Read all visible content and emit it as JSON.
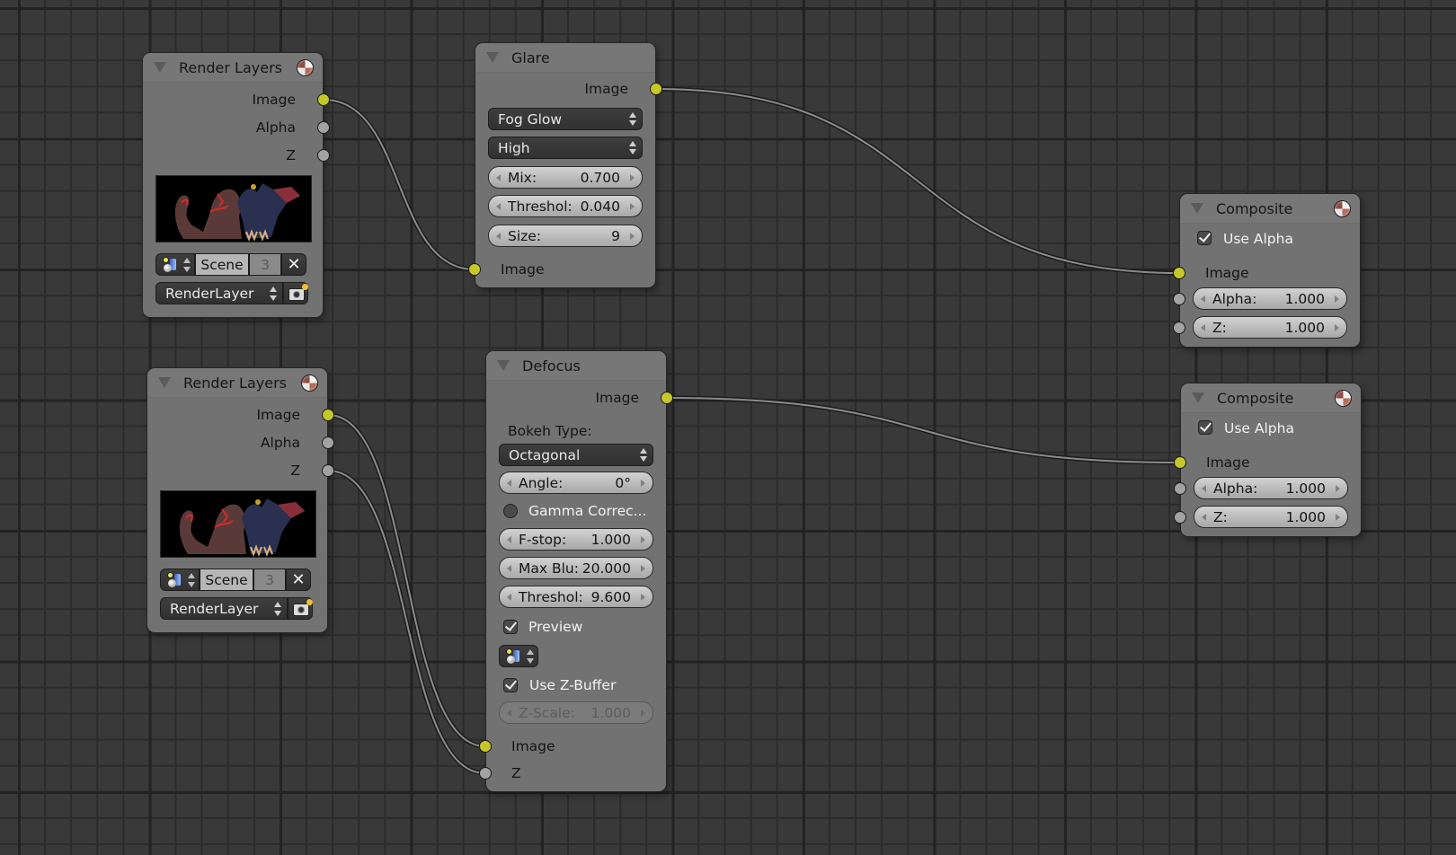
{
  "canvas": {
    "background": "#393939",
    "wire_color": "#8c8c8c",
    "socket_colors": {
      "image": "#c7c729",
      "value": "#a3a3a3"
    }
  },
  "nodes": {
    "render_layers_1": {
      "title": "Render Layers",
      "outputs": [
        "Image",
        "Alpha",
        "Z"
      ],
      "scene": {
        "name": "Scene",
        "users": "3"
      },
      "layer": "RenderLayer"
    },
    "render_layers_2": {
      "title": "Render Layers",
      "outputs": [
        "Image",
        "Alpha",
        "Z"
      ],
      "scene": {
        "name": "Scene",
        "users": "3"
      },
      "layer": "RenderLayer"
    },
    "glare": {
      "title": "Glare",
      "output": "Image",
      "glare_type": "Fog Glow",
      "quality": "High",
      "mix": {
        "label": "Mix:",
        "value": "0.700"
      },
      "threshold": {
        "label": "Threshol:",
        "value": "0.040"
      },
      "size": {
        "label": "Size:",
        "value": "9"
      },
      "input": "Image"
    },
    "defocus": {
      "title": "Defocus",
      "output": "Image",
      "bokeh_label": "Bokeh Type:",
      "bokeh_type": "Octagonal",
      "angle": {
        "label": "Angle:",
        "value": "0°"
      },
      "gamma": {
        "label": "Gamma Correc...",
        "checked": false
      },
      "fstop": {
        "label": "F-stop:",
        "value": "1.000"
      },
      "max_blur": {
        "label": "Max Blu:",
        "value": "20.000"
      },
      "threshold": {
        "label": "Threshol:",
        "value": "9.600"
      },
      "preview": {
        "label": "Preview",
        "checked": true
      },
      "use_zbuffer": {
        "label": "Use Z-Buffer",
        "checked": true
      },
      "zscale": {
        "label": "Z-Scale:",
        "value": "1.000",
        "disabled": true
      },
      "inputs": [
        "Image",
        "Z"
      ]
    },
    "composite_1": {
      "title": "Composite",
      "use_alpha": {
        "label": "Use Alpha",
        "checked": true
      },
      "input": "Image",
      "alpha": {
        "label": "Alpha:",
        "value": "1.000"
      },
      "z": {
        "label": "Z:",
        "value": "1.000"
      }
    },
    "composite_2": {
      "title": "Composite",
      "use_alpha": {
        "label": "Use Alpha",
        "checked": true
      },
      "input": "Image",
      "alpha": {
        "label": "Alpha:",
        "value": "1.000"
      },
      "z": {
        "label": "Z:",
        "value": "1.000"
      }
    }
  },
  "links": [
    {
      "from": "render_layers_1.Image",
      "to": "glare.Image"
    },
    {
      "from": "glare.Image",
      "to": "composite_1.Image"
    },
    {
      "from": "render_layers_2.Image",
      "to": "defocus.Image"
    },
    {
      "from": "render_layers_2.Z",
      "to": "defocus.Z"
    },
    {
      "from": "defocus.Image",
      "to": "composite_2.Image"
    }
  ]
}
